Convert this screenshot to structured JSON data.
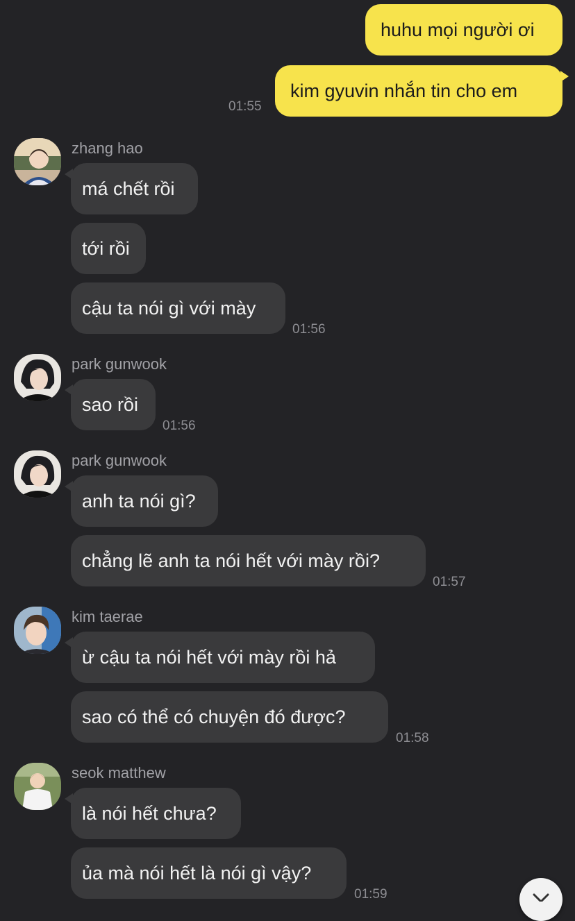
{
  "thread": {
    "outgoing": {
      "messages": [
        "huhu mọi người ơi",
        "kim gyuvin nhắn tin cho em"
      ],
      "time": "01:55"
    },
    "groups": [
      {
        "sender": "zhang hao",
        "messages": [
          "má chết rồi",
          "tới rồi",
          "cậu ta nói gì với mày"
        ],
        "time": "01:56"
      },
      {
        "sender": "park gunwook",
        "messages": [
          "sao rồi"
        ],
        "time": "01:56"
      },
      {
        "sender": "park gunwook",
        "messages": [
          "anh ta nói gì?",
          "chẳng lẽ anh ta nói hết với mày rồi?"
        ],
        "time": "01:57"
      },
      {
        "sender": "kim taerae",
        "messages": [
          "ừ cậu ta nói hết với mày rồi hả",
          "sao có thể có chuyện đó được?"
        ],
        "time": "01:58"
      },
      {
        "sender": "seok matthew",
        "messages": [
          "là nói hết chưa?",
          "ủa mà nói hết là nói gì vậy?"
        ],
        "time": "01:59"
      }
    ]
  },
  "icons": {
    "scroll_down": "chevron-down-icon",
    "avatar": "profile-photo"
  },
  "colors": {
    "background": "#232326",
    "outgoing_bubble": "#f7e34c",
    "incoming_bubble": "#3a3a3c",
    "meta_text": "#8e8e93"
  }
}
